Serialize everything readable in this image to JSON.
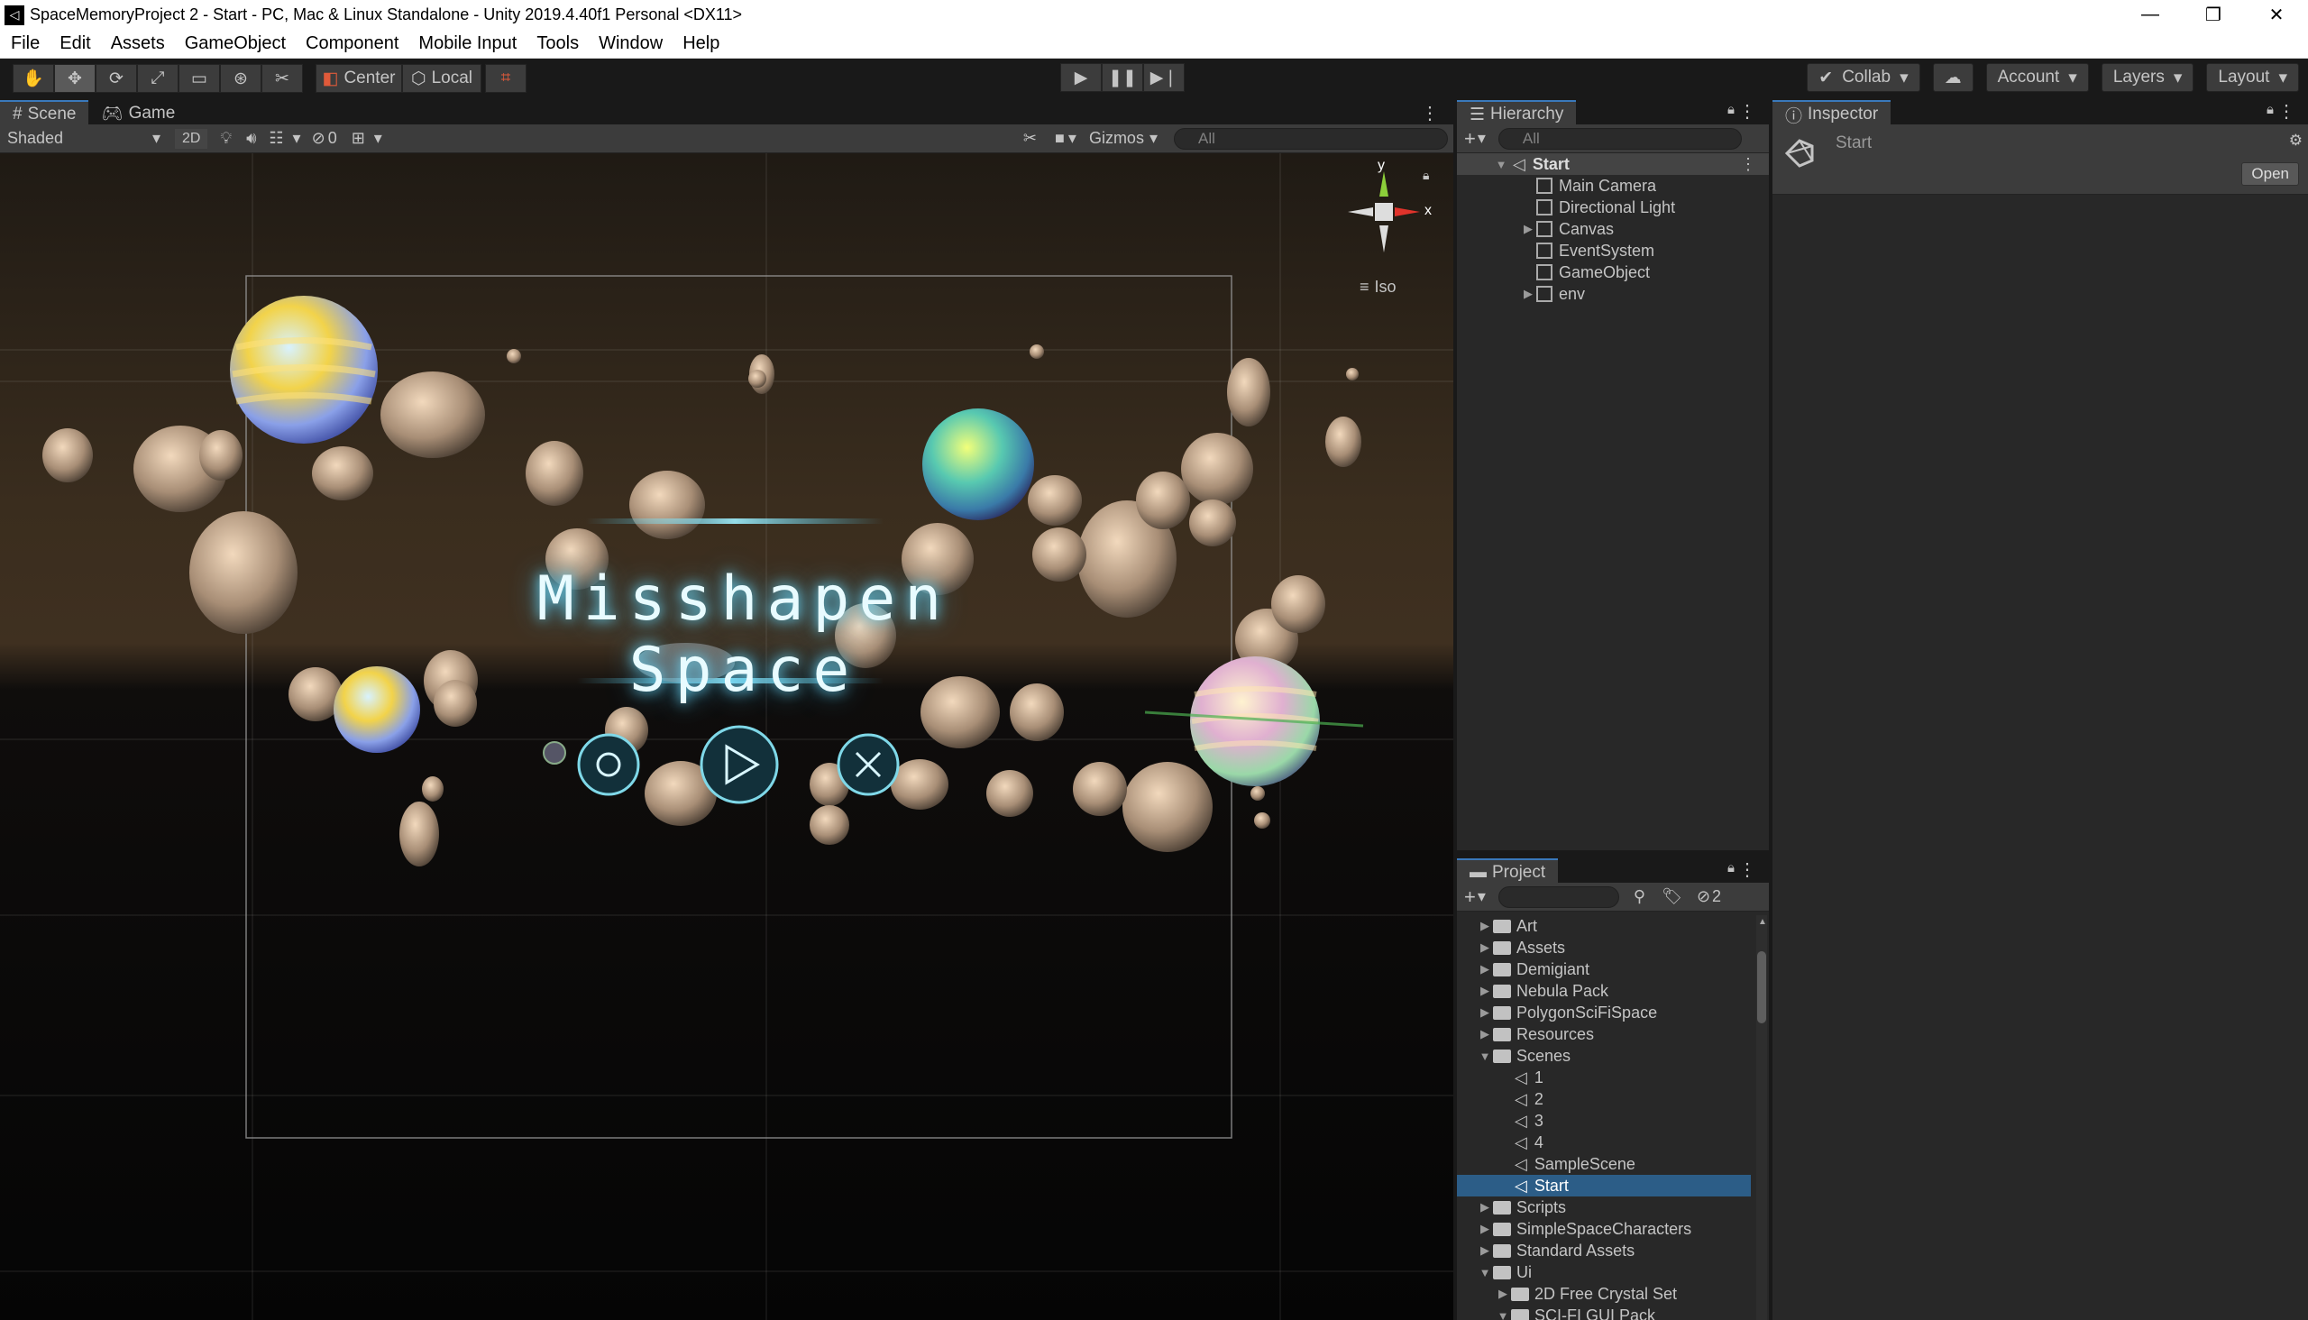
{
  "window": {
    "title": "SpaceMemoryProject 2 - Start - PC, Mac & Linux Standalone - Unity 2019.4.40f1 Personal <DX11>",
    "controls": [
      "—",
      "❐",
      "✕"
    ]
  },
  "menu": [
    "File",
    "Edit",
    "Assets",
    "GameObject",
    "Component",
    "Mobile Input",
    "Tools",
    "Window",
    "Help"
  ],
  "toolbar": {
    "pivot_center": "Center",
    "pivot_local": "Local",
    "collab": "Collab",
    "account": "Account",
    "layers": "Layers",
    "layout": "Layout"
  },
  "scene_tabs": [
    "Scene",
    "Game"
  ],
  "scene_bar": {
    "shading": "Shaded",
    "mode_2d": "2D",
    "hidden_count": "0",
    "gizmos": "Gizmos",
    "search_placeholder": "All"
  },
  "scene_view": {
    "title_text": "Misshapen Space",
    "gizmo_y": "y",
    "gizmo_x": "x",
    "projection": "Iso"
  },
  "hierarchy": {
    "tab": "Hierarchy",
    "search_placeholder": "All",
    "root": "Start",
    "items": [
      "Main Camera",
      "Directional Light",
      "Canvas",
      "EventSystem",
      "GameObject",
      "env"
    ]
  },
  "inspector": {
    "tab": "Inspector",
    "object": "Start",
    "open_button": "Open"
  },
  "project": {
    "tab": "Project",
    "hidden_count": "2",
    "folders_top": [
      "Art",
      "Assets",
      "Demigiant",
      "Nebula Pack",
      "PolygonSciFiSpace",
      "Resources"
    ],
    "scenes_folder": "Scenes",
    "scenes": [
      "1",
      "2",
      "3",
      "4",
      "SampleScene",
      "Start"
    ],
    "folders_bottom": [
      "Scripts",
      "SimpleSpaceCharacters",
      "Standard Assets"
    ],
    "ui_folder": "Ui",
    "ui_children": [
      "2D Free Crystal Set",
      "SCI-FI GUI Pack"
    ]
  },
  "colors": {
    "accent": "#3a79bb",
    "selected_row": "#2c5d87",
    "panel_bg": "#282828",
    "title_glow": "#bfefff"
  }
}
